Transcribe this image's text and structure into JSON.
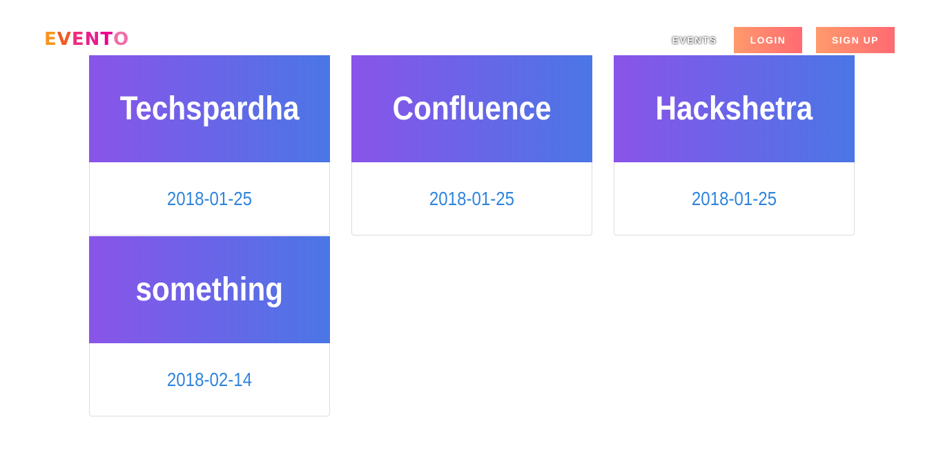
{
  "header": {
    "logo_letters": [
      "E",
      "V",
      "E",
      "N",
      "T",
      "O"
    ],
    "logo_colors": [
      "#f7941d",
      "#f15a24",
      "#ee2a7b",
      "#e91e8c",
      "#ec008c",
      "#f06eaa"
    ],
    "nav": {
      "events_label": "EVENTS"
    },
    "login_label": "LOGIN",
    "signup_label": "SIGN UP",
    "button_gradient": [
      "#ff9a6c",
      "#ff6a72"
    ]
  },
  "events": [
    {
      "title": "Techspardha",
      "date": "2018-01-25"
    },
    {
      "title": "Confluence",
      "date": "2018-01-25"
    },
    {
      "title": "Hackshetra",
      "date": "2018-01-25"
    },
    {
      "title": "something",
      "date": "2018-02-14"
    }
  ],
  "card_gradient": [
    "#8a54e9",
    "#4a76e6"
  ],
  "date_color": "#2f84dc"
}
